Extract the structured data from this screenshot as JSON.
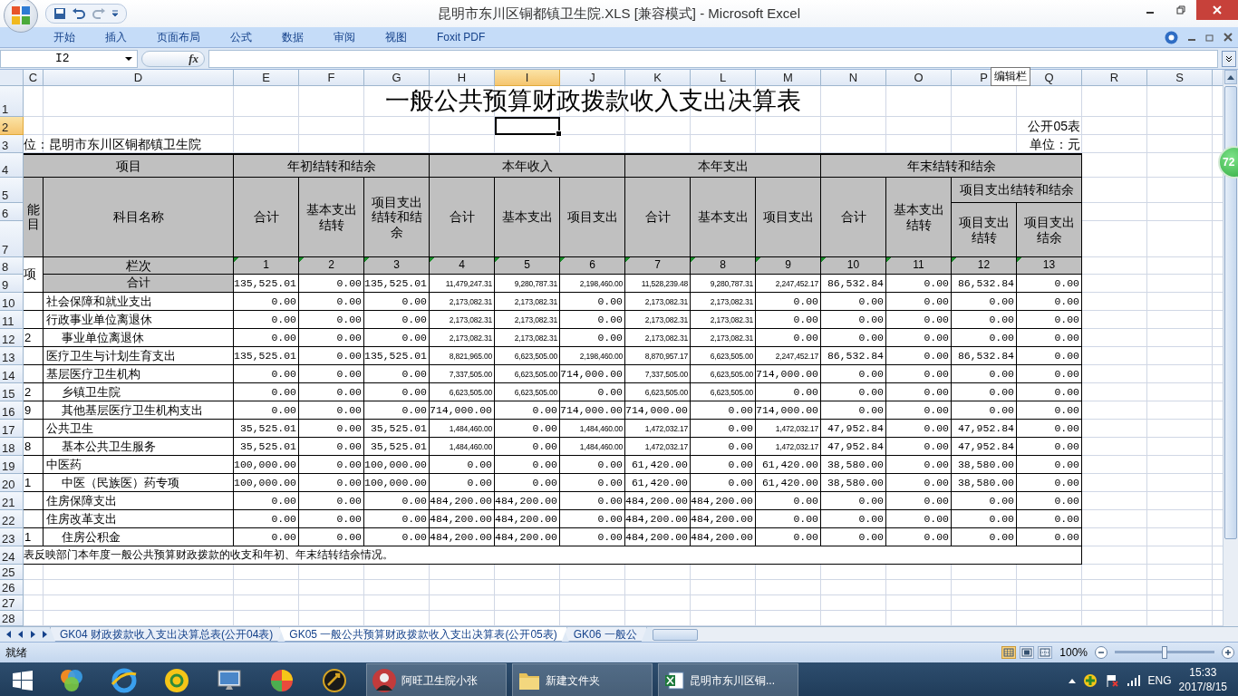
{
  "window": {
    "title": "昆明市东川区铜都镇卫生院.XLS  [兼容模式] - Microsoft Excel"
  },
  "ribbon_tabs": [
    "开始",
    "插入",
    "页面布局",
    "公式",
    "数据",
    "审阅",
    "视图",
    "Foxit PDF"
  ],
  "formula_bar": {
    "name_box": "I2",
    "function_label": "fx",
    "tooltip": "编辑栏"
  },
  "column_letters": [
    {
      "label": "C",
      "selected": false
    },
    {
      "label": "D",
      "selected": false
    },
    {
      "label": "E",
      "selected": false
    },
    {
      "label": "F",
      "selected": false
    },
    {
      "label": "G",
      "selected": false
    },
    {
      "label": "H",
      "selected": false
    },
    {
      "label": "I",
      "selected": true
    },
    {
      "label": "J",
      "selected": false
    },
    {
      "label": "K",
      "selected": false
    },
    {
      "label": "L",
      "selected": false
    },
    {
      "label": "M",
      "selected": false
    },
    {
      "label": "N",
      "selected": false
    },
    {
      "label": "O",
      "selected": false
    },
    {
      "label": "P",
      "selected": false
    },
    {
      "label": "Q",
      "selected": false
    },
    {
      "label": "R",
      "selected": false
    },
    {
      "label": "S",
      "selected": false
    }
  ],
  "row_numbers": [
    {
      "label": "1",
      "selected": false
    },
    {
      "label": "2",
      "selected": true
    },
    {
      "label": "3",
      "selected": false
    },
    {
      "label": "4",
      "selected": false
    },
    {
      "label": "5",
      "selected": false
    },
    {
      "label": "6",
      "selected": false
    },
    {
      "label": "7",
      "selected": false
    },
    {
      "label": "8",
      "selected": false
    },
    {
      "label": "9",
      "selected": false
    },
    {
      "label": "10",
      "selected": false
    },
    {
      "label": "11",
      "selected": false
    },
    {
      "label": "12",
      "selected": false
    },
    {
      "label": "13",
      "selected": false
    },
    {
      "label": "14",
      "selected": false
    },
    {
      "label": "15",
      "selected": false
    },
    {
      "label": "16",
      "selected": false
    },
    {
      "label": "17",
      "selected": false
    },
    {
      "label": "18",
      "selected": false
    },
    {
      "label": "19",
      "selected": false
    },
    {
      "label": "20",
      "selected": false
    },
    {
      "label": "21",
      "selected": false
    },
    {
      "label": "22",
      "selected": false
    },
    {
      "label": "23",
      "selected": false
    },
    {
      "label": "24",
      "selected": false
    },
    {
      "label": "25",
      "selected": false
    },
    {
      "label": "26",
      "selected": false
    },
    {
      "label": "27",
      "selected": false
    },
    {
      "label": "28",
      "selected": false
    }
  ],
  "sheet": {
    "title": "一般公共预算财政拨款收入支出决算表",
    "form_no": "公开05表",
    "unit_org": "位：昆明市东川区铜都镇卫生院",
    "unit_currency": "单位：元",
    "header": {
      "item_group": "项目",
      "code_label": "能目",
      "code_sub": "项",
      "name_label": "科目名称",
      "column_index_label": "栏次",
      "groups": [
        {
          "label": "年初结转和结余",
          "subs": [
            "合计",
            "基本支出结转",
            "项目支出结转和结余"
          ]
        },
        {
          "label": "本年收入",
          "subs": [
            "合计",
            "基本支出",
            "项目支出"
          ]
        },
        {
          "label": "本年支出",
          "subs": [
            "合计",
            "基本支出",
            "项目支出"
          ]
        },
        {
          "label": "年末结转和结余",
          "subs": [
            "合计",
            "基本支出结转"
          ],
          "subgroup": {
            "label": "项目支出结转和结余",
            "subs": [
              "项目支出结转",
              "项目支出结余"
            ]
          }
        }
      ],
      "column_numbers": [
        "1",
        "2",
        "3",
        "4",
        "5",
        "6",
        "7",
        "8",
        "9",
        "10",
        "11",
        "12",
        "13"
      ]
    },
    "total_row": {
      "label": "合计",
      "values": [
        "135,525.01",
        "0.00",
        "135,525.01",
        "11,479,247.31",
        "9,280,787.31",
        "2,198,460.00",
        "11,528,239.48",
        "9,280,787.31",
        "2,247,452.17",
        "86,532.84",
        "0.00",
        "86,532.84",
        "0.00"
      ]
    },
    "rows": [
      {
        "name": "社会保障和就业支出",
        "values": [
          "0.00",
          "0.00",
          "0.00",
          "2,173,082.31",
          "2,173,082.31",
          "0.00",
          "2,173,082.31",
          "2,173,082.31",
          "0.00",
          "0.00",
          "0.00",
          "0.00",
          "0.00"
        ]
      },
      {
        "name": "行政事业单位离退休",
        "values": [
          "0.00",
          "0.00",
          "0.00",
          "2,173,082.31",
          "2,173,082.31",
          "0.00",
          "2,173,082.31",
          "2,173,082.31",
          "0.00",
          "0.00",
          "0.00",
          "0.00",
          "0.00"
        ],
        "children": [
          {
            "code": "2",
            "name": "事业单位离退休",
            "values": [
              "0.00",
              "0.00",
              "0.00",
              "2,173,082.31",
              "2,173,082.31",
              "0.00",
              "2,173,082.31",
              "2,173,082.31",
              "0.00",
              "0.00",
              "0.00",
              "0.00",
              "0.00"
            ]
          }
        ]
      },
      {
        "name": "医疗卫生与计划生育支出",
        "values": [
          "135,525.01",
          "0.00",
          "135,525.01",
          "8,821,965.00",
          "6,623,505.00",
          "2,198,460.00",
          "8,870,957.17",
          "6,623,505.00",
          "2,247,452.17",
          "86,532.84",
          "0.00",
          "86,532.84",
          "0.00"
        ]
      },
      {
        "name": "基层医疗卫生机构",
        "values": [
          "0.00",
          "0.00",
          "0.00",
          "7,337,505.00",
          "6,623,505.00",
          "714,000.00",
          "7,337,505.00",
          "6,623,505.00",
          "714,000.00",
          "0.00",
          "0.00",
          "0.00",
          "0.00"
        ],
        "children": [
          {
            "code": "2",
            "name": "乡镇卫生院",
            "values": [
              "0.00",
              "0.00",
              "0.00",
              "6,623,505.00",
              "6,623,505.00",
              "0.00",
              "6,623,505.00",
              "6,623,505.00",
              "0.00",
              "0.00",
              "0.00",
              "0.00",
              "0.00"
            ]
          },
          {
            "code": "9",
            "name": "其他基层医疗卫生机构支出",
            "values": [
              "0.00",
              "0.00",
              "0.00",
              "714,000.00",
              "0.00",
              "714,000.00",
              "714,000.00",
              "0.00",
              "714,000.00",
              "0.00",
              "0.00",
              "0.00",
              "0.00"
            ]
          }
        ]
      },
      {
        "name": "公共卫生",
        "values": [
          "35,525.01",
          "0.00",
          "35,525.01",
          "1,484,460.00",
          "0.00",
          "1,484,460.00",
          "1,472,032.17",
          "0.00",
          "1,472,032.17",
          "47,952.84",
          "0.00",
          "47,952.84",
          "0.00"
        ],
        "children": [
          {
            "code": "8",
            "name": "基本公共卫生服务",
            "values": [
              "35,525.01",
              "0.00",
              "35,525.01",
              "1,484,460.00",
              "0.00",
              "1,484,460.00",
              "1,472,032.17",
              "0.00",
              "1,472,032.17",
              "47,952.84",
              "0.00",
              "47,952.84",
              "0.00"
            ]
          }
        ]
      },
      {
        "name": "中医药",
        "values": [
          "100,000.00",
          "0.00",
          "100,000.00",
          "0.00",
          "0.00",
          "0.00",
          "61,420.00",
          "0.00",
          "61,420.00",
          "38,580.00",
          "0.00",
          "38,580.00",
          "0.00"
        ],
        "children": [
          {
            "code": "1",
            "name": "中医（民族医）药专项",
            "values": [
              "100,000.00",
              "0.00",
              "100,000.00",
              "0.00",
              "0.00",
              "0.00",
              "61,420.00",
              "0.00",
              "61,420.00",
              "38,580.00",
              "0.00",
              "38,580.00",
              "0.00"
            ]
          }
        ]
      },
      {
        "name": "住房保障支出",
        "values": [
          "0.00",
          "0.00",
          "0.00",
          "484,200.00",
          "484,200.00",
          "0.00",
          "484,200.00",
          "484,200.00",
          "0.00",
          "0.00",
          "0.00",
          "0.00",
          "0.00"
        ]
      },
      {
        "name": "住房改革支出",
        "values": [
          "0.00",
          "0.00",
          "0.00",
          "484,200.00",
          "484,200.00",
          "0.00",
          "484,200.00",
          "484,200.00",
          "0.00",
          "0.00",
          "0.00",
          "0.00",
          "0.00"
        ],
        "children": [
          {
            "code": "1",
            "name": "住房公积金",
            "values": [
              "0.00",
              "0.00",
              "0.00",
              "484,200.00",
              "484,200.00",
              "0.00",
              "484,200.00",
              "484,200.00",
              "0.00",
              "0.00",
              "0.00",
              "0.00",
              "0.00"
            ]
          }
        ]
      }
    ],
    "note": "表反映部门本年度一般公共预算财政拨款的收支和年初、年末结转结余情况。"
  },
  "floating_badge": "72",
  "sheet_tabs": [
    {
      "label": "GK04 财政拨款收入支出决算总表(公开04表)",
      "selected": false
    },
    {
      "label": "GK05 一般公共预算财政拨款收入支出决算表(公开05表)",
      "selected": true
    },
    {
      "label": "GK06 一般公",
      "selected": false
    }
  ],
  "status_bar": {
    "status": "就绪",
    "views": [
      {
        "kind": "normal",
        "selected": true
      },
      {
        "kind": "layout",
        "selected": false
      },
      {
        "kind": "pagebreak",
        "selected": false
      }
    ],
    "zoom": "100%",
    "zoom_slider": {
      "level": 0.5
    }
  },
  "taskbar": {
    "windows": [
      {
        "kind": "avatar",
        "label": "阿旺卫生院小张"
      },
      {
        "kind": "folder",
        "label": "新建文件夹"
      },
      {
        "kind": "excel",
        "label": "昆明市东川区铜..."
      }
    ],
    "language": "ENG",
    "time": "15:33",
    "date": "2017/8/15"
  }
}
